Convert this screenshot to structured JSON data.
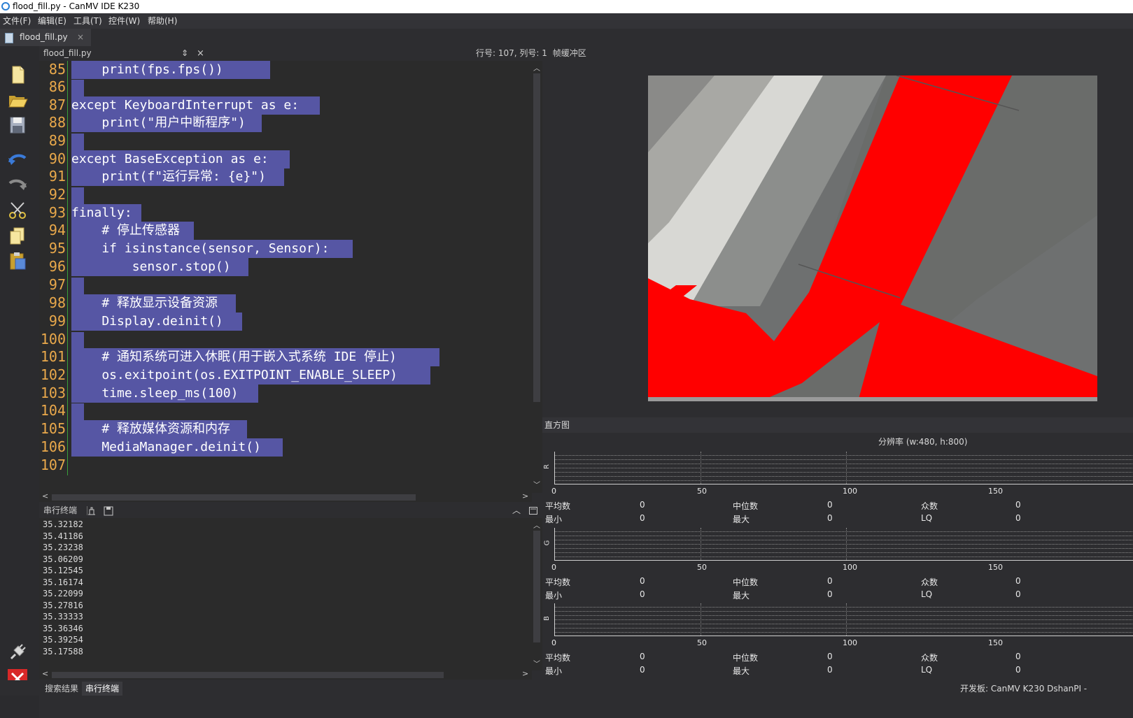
{
  "window": {
    "title": "flood_fill.py - CanMV IDE K230"
  },
  "menu": [
    "文件(F)",
    "编辑(E)",
    "工具(T)",
    "控件(W)",
    "帮助(H)"
  ],
  "tab": {
    "filename": "flood_fill.py",
    "close": "×"
  },
  "toolbar": [
    "new-file-icon",
    "open-folder-icon",
    "save-icon",
    "undo-icon",
    "redo-icon",
    "cut-icon",
    "copy-icon",
    "paste-icon"
  ],
  "editor": {
    "filename": "flood_fill.py",
    "sort_arrow": "⇕",
    "close": "×",
    "position": "行号: 107, 列号: 1",
    "frame_buffer_label": "帧缓冲区",
    "lines": [
      {
        "n": "85",
        "text": "    print(fps.fps())"
      },
      {
        "n": "86",
        "text": ""
      },
      {
        "n": "87",
        "text": "except KeyboardInterrupt as e:"
      },
      {
        "n": "88",
        "text": "    print(\"用户中断程序\")"
      },
      {
        "n": "89",
        "text": ""
      },
      {
        "n": "90",
        "text": "except BaseException as e:"
      },
      {
        "n": "91",
        "text": "    print(f\"运行异常: {e}\")"
      },
      {
        "n": "92",
        "text": ""
      },
      {
        "n": "93",
        "text": "finally:"
      },
      {
        "n": "94",
        "text": "    # 停止传感器"
      },
      {
        "n": "95",
        "text": "    if isinstance(sensor, Sensor):"
      },
      {
        "n": "96",
        "text": "        sensor.stop()"
      },
      {
        "n": "97",
        "text": ""
      },
      {
        "n": "98",
        "text": "    # 释放显示设备资源"
      },
      {
        "n": "99",
        "text": "    Display.deinit()"
      },
      {
        "n": "100",
        "text": ""
      },
      {
        "n": "101",
        "text": "    # 通知系统可进入休眠(用于嵌入式系统 IDE 停止)"
      },
      {
        "n": "102",
        "text": "    os.exitpoint(os.EXITPOINT_ENABLE_SLEEP)"
      },
      {
        "n": "103",
        "text": "    time.sleep_ms(100)"
      },
      {
        "n": "104",
        "text": ""
      },
      {
        "n": "105",
        "text": "    # 释放媒体资源和内存"
      },
      {
        "n": "106",
        "text": "    MediaManager.deinit()"
      },
      {
        "n": "107",
        "text": ""
      }
    ]
  },
  "terminal": {
    "title": "串行终端",
    "lines": [
      "35.32182",
      "35.41186",
      "35.23238",
      "35.06209",
      "35.12545",
      "35.16174",
      "35.22099",
      "35.27816",
      "35.33333",
      "35.36346",
      "35.39254",
      "35.17588"
    ]
  },
  "bottom_tabs": [
    "搜索结果",
    "串行终端"
  ],
  "histogram": {
    "title": "直方图",
    "resolution": "分辨率 (w:480, h:800)",
    "ticks": [
      "0",
      "50",
      "100",
      "150"
    ],
    "channels": [
      {
        "axis": "R",
        "mean": "0",
        "median": "0",
        "mode": "0",
        "min": "0",
        "max": "0",
        "lq": "0"
      },
      {
        "axis": "G",
        "mean": "0",
        "median": "0",
        "mode": "0",
        "min": "0",
        "max": "0",
        "lq": "0"
      },
      {
        "axis": "B",
        "mean": "0",
        "median": "0",
        "mode": "0",
        "min": "0",
        "max": "0",
        "lq": "0"
      }
    ],
    "labels": {
      "mean": "平均数",
      "median": "中位数",
      "mode": "众数",
      "min": "最小",
      "max": "最大",
      "lq": "LQ"
    }
  },
  "status": {
    "board": "开发板: CanMV K230 DshanPI -"
  },
  "colors": {
    "fill_red": "#ff0000",
    "selection": "#5656a4",
    "line_numbers": "#eaa94b"
  }
}
